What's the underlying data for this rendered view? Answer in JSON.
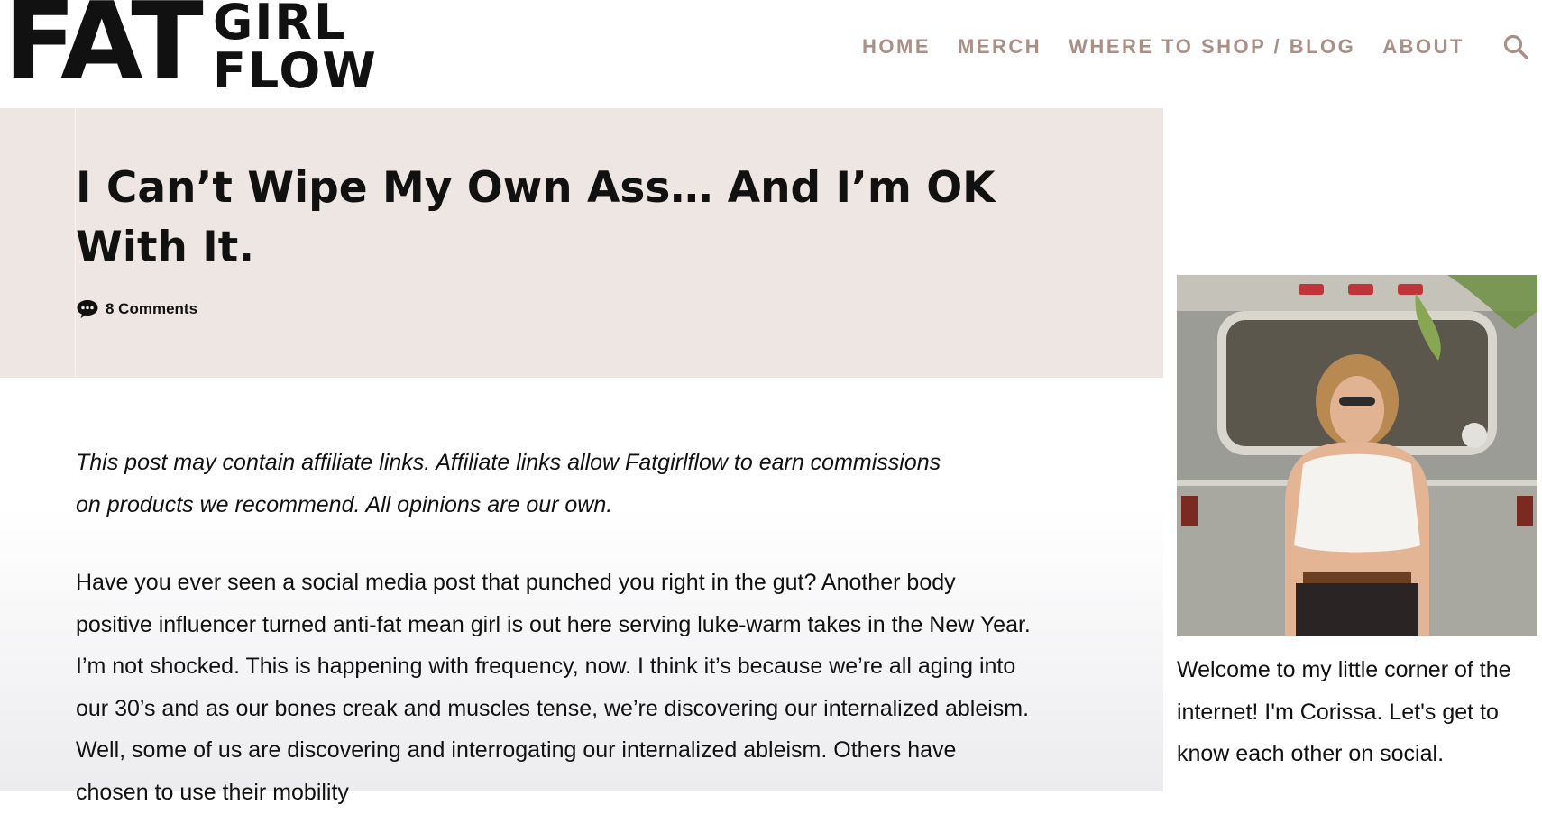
{
  "header": {
    "logo": {
      "line1": "FAT",
      "line2": "GIRL",
      "line3": "FLOW"
    },
    "nav": [
      {
        "label": "HOME"
      },
      {
        "label": "MERCH"
      },
      {
        "label": "WHERE TO SHOP / BLOG"
      },
      {
        "label": "ABOUT"
      }
    ],
    "search_icon": "search-icon"
  },
  "post": {
    "title": "I Can’t Wipe My Own Ass… And I’m OK With It.",
    "comments": "8 Comments",
    "comments_icon": "comment-bubble-icon",
    "disclaimer": "This post may contain affiliate links. Affiliate links allow Fatgirlflow to earn commissions on products we recommend. All opinions are our own.",
    "body": "Have you ever seen a social media post that punched you right in the gut? Another body positive influencer turned anti-fat mean girl is out here serving luke-warm takes in the New Year. I’m not shocked. This is happening with frequency, now. I think it’s because we’re all aging into our 30’s and as our bones creak and muscles tense, we’re discovering our internalized ableism. Well, some of us are discovering and interrogating our internalized ableism. Others have chosen to use their mobility"
  },
  "sidebar": {
    "welcome": "Welcome to my little corner of the internet! I'm Corissa. Let's get to know each other on social."
  },
  "colors": {
    "nav": "#a98f86",
    "title_band": "#ede6e2",
    "text": "#111111"
  }
}
